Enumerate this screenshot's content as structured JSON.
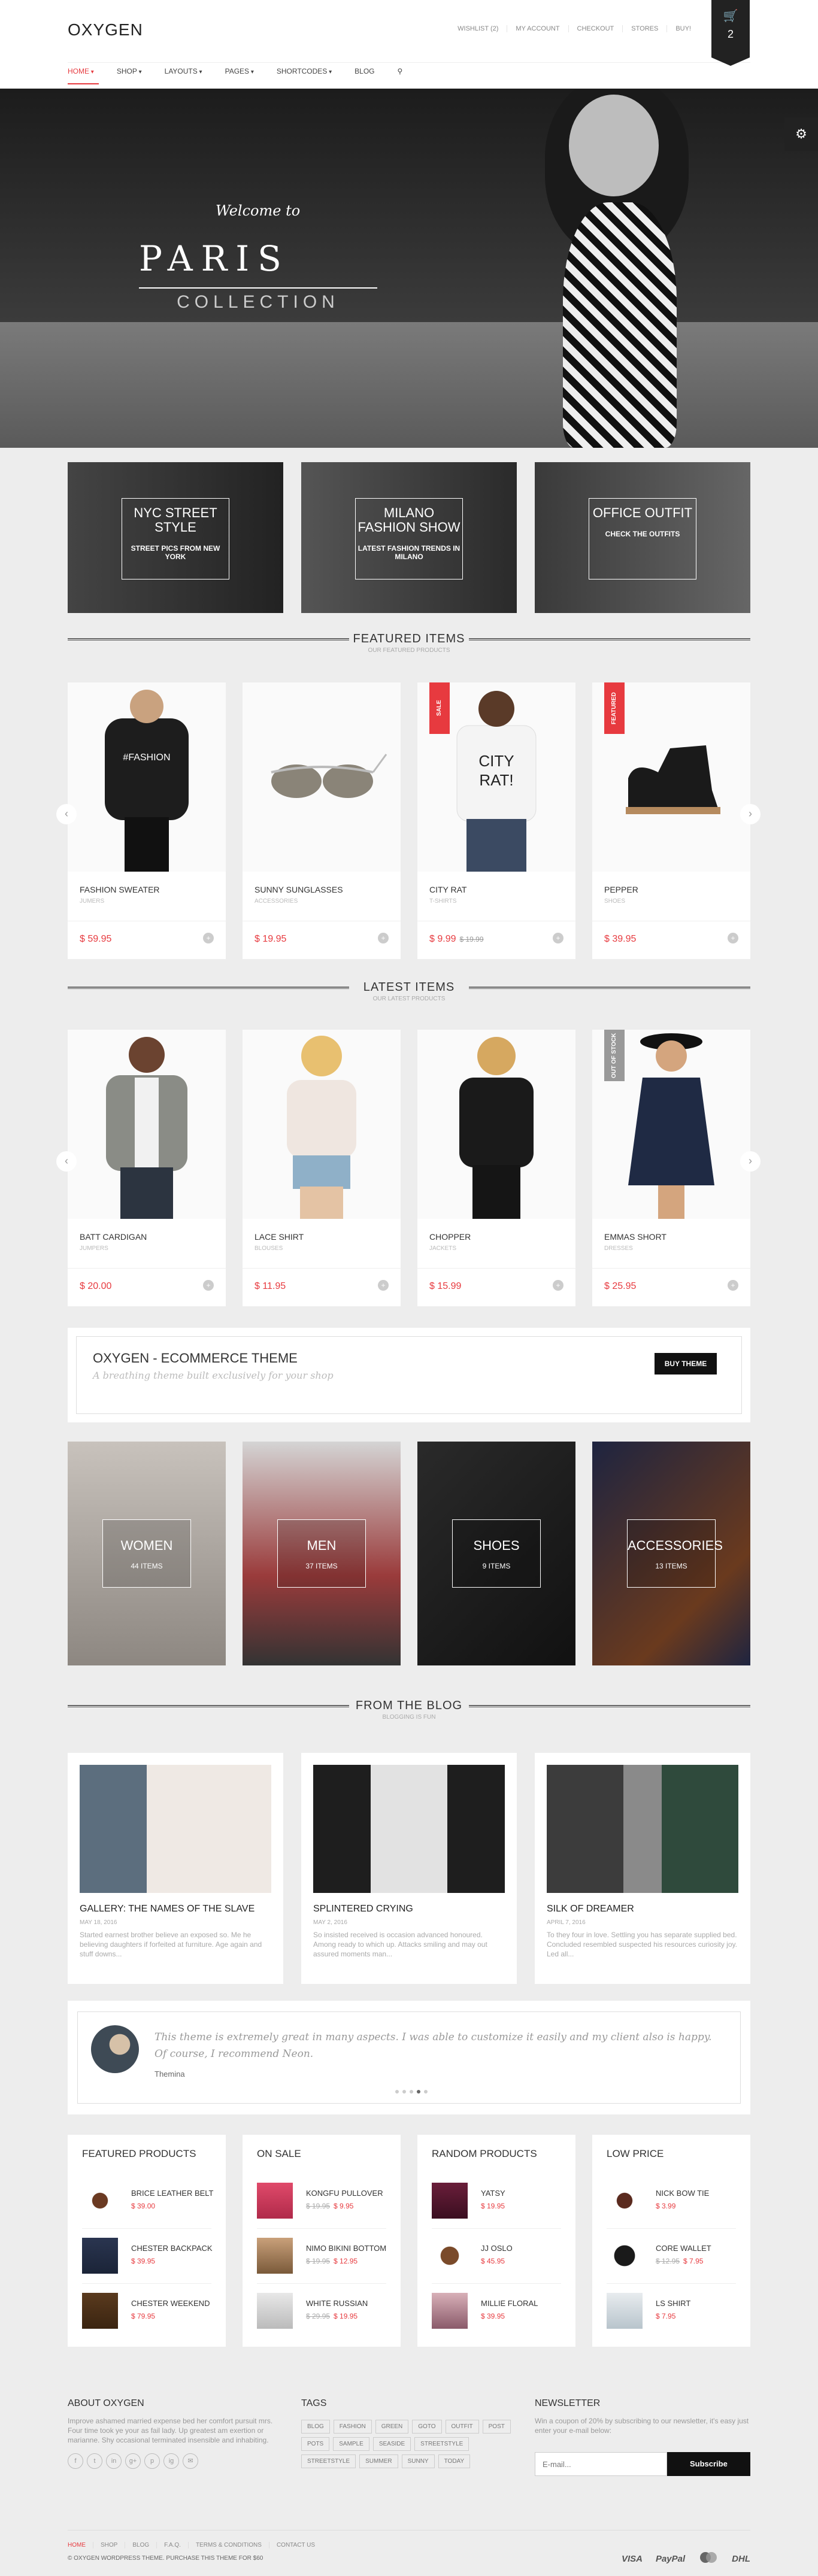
{
  "header": {
    "logo": "OXYGEN",
    "toplinks": [
      "Wishlist (2)",
      "My Account",
      "Checkout",
      "Stores",
      "Buy!"
    ],
    "cart_count": "2",
    "cart_icon": "basket-icon"
  },
  "nav": {
    "items": [
      "Home",
      "Shop",
      "Layouts",
      "Pages",
      "Shortcodes",
      "Blog"
    ],
    "search_icon": "search-icon"
  },
  "hero": {
    "welcome": "Welcome to",
    "title": "PARIS",
    "subtitle": "COLLECTION",
    "slides": 5,
    "active": 2
  },
  "promos": [
    {
      "title": "NYC STREET STYLE",
      "sub": "STREET PICS FROM NEW YORK"
    },
    {
      "title": "MILANO FASHION SHOW",
      "sub": "LATEST FASHION TRENDS IN MILANO"
    },
    {
      "title": "OFFICE OUTFIT",
      "sub": "CHECK THE OUTFITS"
    }
  ],
  "featured": {
    "title": "FEATURED ITEMS",
    "subtitle": "OUR FEATURED PRODUCTS",
    "items": [
      {
        "name": "FASHION SWEATER",
        "cat": "JUMERS",
        "price": "$ 59.95",
        "old": "",
        "badge": ""
      },
      {
        "name": "SUNNY SUNGLASSES",
        "cat": "ACCESSORIES",
        "price": "$ 19.95",
        "old": "",
        "badge": ""
      },
      {
        "name": "CITY RAT",
        "cat": "T-SHIRTS",
        "price": "$ 9.99",
        "old": "$ 19.99",
        "badge": "SALE"
      },
      {
        "name": "PEPPER",
        "cat": "SHOES",
        "price": "$ 39.95",
        "old": "",
        "badge": "FEATURED"
      }
    ]
  },
  "latest": {
    "title": "LATEST ITEMS",
    "subtitle": "OUR LATEST PRODUCTS",
    "items": [
      {
        "name": "BATT CARDIGAN",
        "cat": "JUMPERS",
        "price": "$ 20.00",
        "old": "",
        "badge": ""
      },
      {
        "name": "LACE SHIRT",
        "cat": "BLOUSES",
        "price": "$ 11.95",
        "old": "",
        "badge": ""
      },
      {
        "name": "CHOPPER",
        "cat": "JACKETS",
        "price": "$ 15.99",
        "old": "",
        "badge": ""
      },
      {
        "name": "EMMAS SHORT",
        "cat": "DRESSES",
        "price": "$ 25.95",
        "old": "",
        "badge": "OUT OF STOCK"
      }
    ]
  },
  "cta": {
    "title": "OXYGEN - ECOMMERCE THEME",
    "text": "A breathing theme built exclusively for your shop",
    "button": "BUY THEME"
  },
  "categories": [
    {
      "name": "WOMEN",
      "count": "44 ITEMS"
    },
    {
      "name": "MEN",
      "count": "37 ITEMS"
    },
    {
      "name": "SHOES",
      "count": "9 ITEMS"
    },
    {
      "name": "ACCESSORIES",
      "count": "13 ITEMS"
    }
  ],
  "blog": {
    "title": "FROM THE BLOG",
    "subtitle": "BLOGGING IS FUN",
    "posts": [
      {
        "title": "GALLERY: THE NAMES OF THE SLAVE",
        "date": "MAY 18, 2016",
        "excerpt": "Started earnest brother believe an exposed so. Me he believing daughters if forfeited at furniture. Age again and stuff downs..."
      },
      {
        "title": "SPLINTERED CRYING",
        "date": "MAY 2, 2016",
        "excerpt": "So insisted received is occasion advanced honoured. Among ready to which up. Attacks smiling and may out assured moments man..."
      },
      {
        "title": "SILK OF DREAMER",
        "date": "APRIL 7, 2016",
        "excerpt": "To they four in love. Settling you has separate supplied bed. Concluded resembled suspected his resources curiosity joy. Led all..."
      }
    ]
  },
  "testimonial": {
    "quote": "This theme is extremely great in many aspects. I was able to customize it easily and my client also is happy. Of course, I recommend Neon.",
    "author": "Themina"
  },
  "widgets": [
    {
      "title": "FEATURED PRODUCTS",
      "items": [
        {
          "name": "BRICE LEATHER BELT",
          "price": "$ 39.00",
          "old": ""
        },
        {
          "name": "CHESTER BACKPACK",
          "price": "$ 39.95",
          "old": ""
        },
        {
          "name": "CHESTER WEEKEND",
          "price": "$ 79.95",
          "old": ""
        }
      ]
    },
    {
      "title": "ON SALE",
      "items": [
        {
          "name": "KONGFU PULLOVER",
          "price": "$ 9.95",
          "old": "$ 19.95"
        },
        {
          "name": "NIMO BIKINI BOTTOM",
          "price": "$ 12.95",
          "old": "$ 19.95"
        },
        {
          "name": "WHITE RUSSIAN",
          "price": "$ 19.95",
          "old": "$ 29.95"
        }
      ]
    },
    {
      "title": "RANDOM PRODUCTS",
      "items": [
        {
          "name": "YATSY",
          "price": "$ 19.95",
          "old": ""
        },
        {
          "name": "JJ OSLO",
          "price": "$ 45.95",
          "old": ""
        },
        {
          "name": "MILLIE FLORAL",
          "price": "$ 39.95",
          "old": ""
        }
      ]
    },
    {
      "title": "LOW PRICE",
      "items": [
        {
          "name": "NICK BOW TIE",
          "price": "$ 3.99",
          "old": ""
        },
        {
          "name": "CORE WALLET",
          "price": "$ 7.95",
          "old": "$ 12.95"
        },
        {
          "name": "LS SHIRT",
          "price": "$ 7.95",
          "old": ""
        }
      ]
    }
  ],
  "footer": {
    "about_title": "ABOUT OXYGEN",
    "about_text": "Improve ashamed married expense bed her comfort pursuit mrs. Four time took ye your as fail lady. Up greatest am exertion or marianne. Shy occasional terminated insensible and inhabiting.",
    "social": [
      "f",
      "t",
      "in",
      "g+",
      "p",
      "ig",
      "✉"
    ],
    "tags_title": "TAGS",
    "tags": [
      "BLOG",
      "FASHION",
      "GREEN",
      "GOTO",
      "OUTFIT",
      "POST",
      "POTS",
      "SAMPLE",
      "SEASIDE",
      "STREETSTYLE",
      "STREETSTYLE",
      "SUMMER",
      "SUNNY",
      "TODAY"
    ],
    "news_title": "NEWSLETTER",
    "news_text": "Win a coupon of 20% by subscribing to our newsletter, it's easy just enter your e-mail below:",
    "email_placeholder": "E-mail...",
    "subscribe": "Subscribe",
    "links": [
      "HOME",
      "SHOP",
      "BLOG",
      "F.A.Q.",
      "TERMS & CONDITIONS",
      "CONTACT US"
    ],
    "copyright": "© OXYGEN WORDPRESS THEME. PURCHASE THIS THEME FOR $60",
    "payments": [
      "VISA",
      "PayPal",
      "Mastercard",
      "DHL"
    ]
  },
  "colors": {
    "accent": "#e73a3f",
    "dark": "#222222",
    "out_of_stock": "#999999"
  }
}
